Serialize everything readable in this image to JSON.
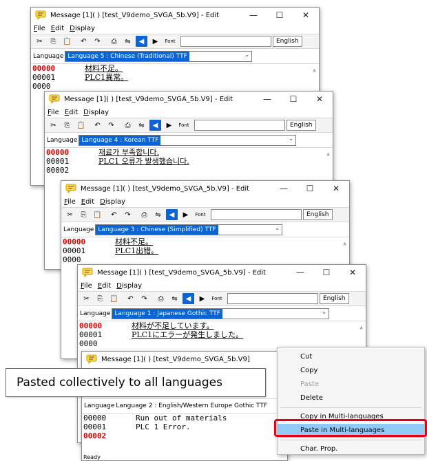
{
  "common": {
    "menu": [
      "File",
      "Edit",
      "Display"
    ],
    "language_label": "Language",
    "lang_button": "English",
    "font_button": "Font",
    "status_ready": "Read",
    "status_ready_full": "Ready",
    "title_min": "—",
    "title_max": "☐",
    "title_close": "✕"
  },
  "windows": [
    {
      "title": "Message [1](          ) [test_V9demo_SVGA_5b.V9] - Edit",
      "language": "Language 5 : Chinese (Traditional) TTF",
      "rows": [
        {
          "num": "00000",
          "text": "材料不足。",
          "current": true
        },
        {
          "num": "00001",
          "text": "PLC1異常。",
          "current": false
        },
        {
          "num": "0000",
          "text": "",
          "current": false
        }
      ]
    },
    {
      "title": "Message [1](          ) [test_V9demo_SVGA_5b.V9] - Edit",
      "language": "Language 4 : Korean TTF",
      "rows": [
        {
          "num": "00000",
          "text": "재료가 부족합니다.",
          "current": true
        },
        {
          "num": "00001",
          "text": "PLC1 오류가 발생했습니다.",
          "current": false
        },
        {
          "num": "00002",
          "text": "",
          "current": false
        }
      ]
    },
    {
      "title": "Message [1](          ) [test_V9demo_SVGA_5b.V9] - Edit",
      "language": "Language 3 : Chinese (Simplified) TTF",
      "rows": [
        {
          "num": "00000",
          "text": "材料不足。",
          "current": true
        },
        {
          "num": "00001",
          "text": "PLC1出错。",
          "current": false
        },
        {
          "num": "0000",
          "text": "",
          "current": false
        }
      ]
    },
    {
      "title": "Message [1](          ) [test_V9demo_SVGA_5b.V9] - Edit",
      "language": "Language 1 : Japanese Gothic TTF",
      "rows": [
        {
          "num": "00000",
          "text": "材料が不足しています。",
          "current": true
        },
        {
          "num": "00001",
          "text": "PLC1にエラーが発生しました。",
          "current": false
        },
        {
          "num": "0000",
          "text": "",
          "current": false
        }
      ]
    },
    {
      "title": "Message [1](          ) [test_V9demo_SVGA_5b.V9]",
      "language": "Language 2 : English/Western Europe Gothic TTF",
      "rows": [
        {
          "num": "00000",
          "text": "Run out of materials",
          "current": false
        },
        {
          "num": "00001",
          "text": "PLC 1 Error.",
          "current": false
        },
        {
          "num": "00002",
          "text": "",
          "current": true
        }
      ]
    }
  ],
  "callout": "Pasted collectively to all languages",
  "context_menu": [
    {
      "label": "Cut",
      "disabled": false
    },
    {
      "label": "Copy",
      "disabled": false
    },
    {
      "label": "Paste",
      "disabled": true
    },
    {
      "label": "Delete",
      "disabled": false
    },
    {
      "label": "Copy in Multi-languages",
      "disabled": false
    },
    {
      "label": "Paste in Multi-languages",
      "disabled": false,
      "highlighted": true
    },
    {
      "label": "Char. Prop.",
      "disabled": false
    }
  ],
  "colors": {
    "accent_selection": "#0a64d6",
    "row_current": "#e00000",
    "highlight_box": "#e60012",
    "menu_highlight": "#91c9f7"
  }
}
